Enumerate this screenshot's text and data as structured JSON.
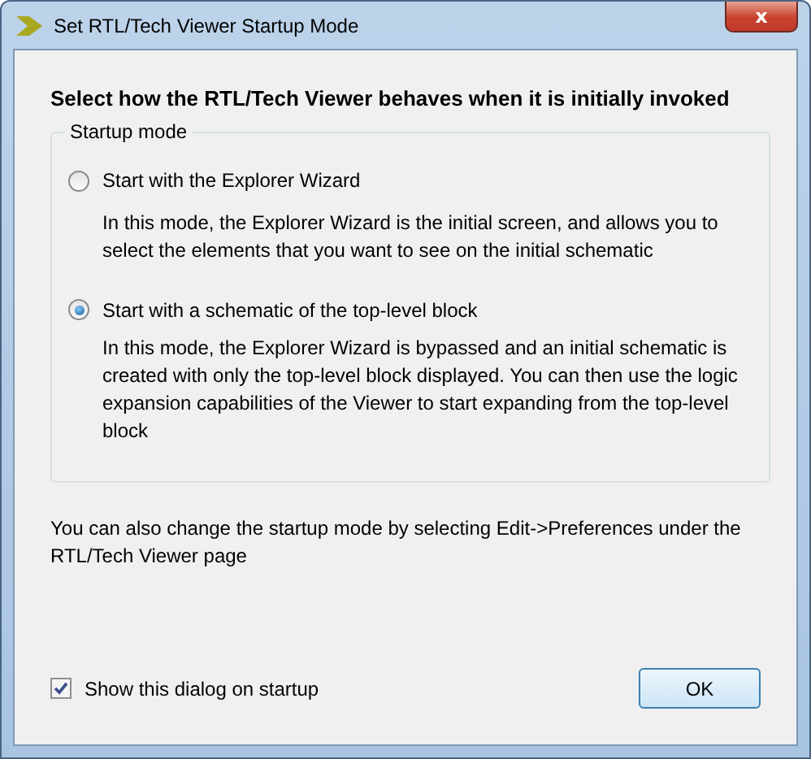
{
  "window": {
    "title": "Set RTL/Tech Viewer Startup Mode",
    "close": "x"
  },
  "heading": "Select how the RTL/Tech Viewer behaves when it is initially invoked",
  "group": {
    "legend": "Startup mode",
    "options": [
      {
        "label": "Start with the Explorer Wizard",
        "selected": false,
        "description": "In this mode, the Explorer Wizard is the initial screen, and allows you to select the elements that you want to see on the initial schematic"
      },
      {
        "label": "Start with a schematic of the top-level block",
        "selected": true,
        "description": "In this mode, the Explorer Wizard is bypassed and an initial schematic is created with only the top-level block displayed. You can then use the logic expansion capabilities of the Viewer to start expanding from the top-level block"
      }
    ]
  },
  "note": "You can also change the startup mode by selecting Edit->Preferences under the RTL/Tech Viewer page",
  "checkbox": {
    "label": "Show this dialog on startup",
    "checked": true
  },
  "buttons": [
    "OK"
  ]
}
